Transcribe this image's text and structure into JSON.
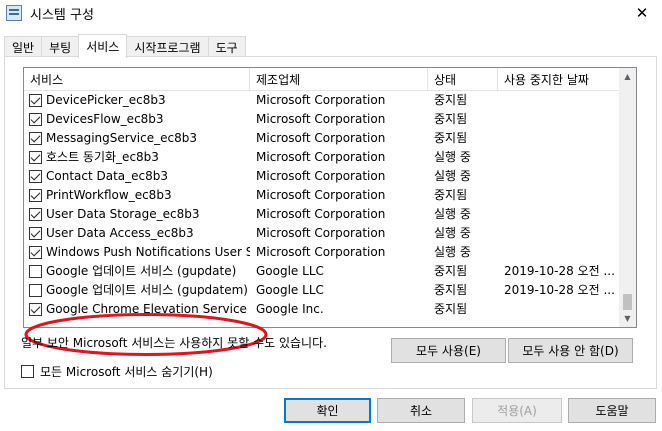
{
  "window": {
    "title": "시스템 구성",
    "close_glyph": "✕"
  },
  "tabs": [
    {
      "label": "일반",
      "active": false
    },
    {
      "label": "부팅",
      "active": false
    },
    {
      "label": "서비스",
      "active": true
    },
    {
      "label": "시작프로그램",
      "active": false
    },
    {
      "label": "도구",
      "active": false
    }
  ],
  "services": {
    "columns": [
      "서비스",
      "제조업체",
      "상태",
      "사용 중지한 날짜"
    ],
    "rows": [
      {
        "name": "DevicePicker_ec8b3",
        "maker": "Microsoft Corporation",
        "state": "중지됨",
        "date": "",
        "checked": true
      },
      {
        "name": "DevicesFlow_ec8b3",
        "maker": "Microsoft Corporation",
        "state": "중지됨",
        "date": "",
        "checked": true
      },
      {
        "name": "MessagingService_ec8b3",
        "maker": "Microsoft Corporation",
        "state": "중지됨",
        "date": "",
        "checked": true
      },
      {
        "name": "호스트 동기화_ec8b3",
        "maker": "Microsoft Corporation",
        "state": "실행 중",
        "date": "",
        "checked": true
      },
      {
        "name": "Contact Data_ec8b3",
        "maker": "Microsoft Corporation",
        "state": "실행 중",
        "date": "",
        "checked": true
      },
      {
        "name": "PrintWorkflow_ec8b3",
        "maker": "Microsoft Corporation",
        "state": "중지됨",
        "date": "",
        "checked": true
      },
      {
        "name": "User Data Storage_ec8b3",
        "maker": "Microsoft Corporation",
        "state": "실행 중",
        "date": "",
        "checked": true
      },
      {
        "name": "User Data Access_ec8b3",
        "maker": "Microsoft Corporation",
        "state": "실행 중",
        "date": "",
        "checked": true
      },
      {
        "name": "Windows Push Notifications User S...",
        "maker": "Microsoft Corporation",
        "state": "실행 중",
        "date": "",
        "checked": true
      },
      {
        "name": "Google 업데이트 서비스 (gupdate)",
        "maker": "Google LLC",
        "state": "중지됨",
        "date": "2019-10-28 오전 ...",
        "checked": false
      },
      {
        "name": "Google 업데이트 서비스 (gupdatem)",
        "maker": "Google LLC",
        "state": "중지됨",
        "date": "2019-10-28 오전 ...",
        "checked": false
      },
      {
        "name": "Google Chrome Elevation Service",
        "maker": "Google Inc.",
        "state": "중지됨",
        "date": "",
        "checked": true
      }
    ]
  },
  "warning_text": "일부 보안 Microsoft 서비스는 사용하지 못할 수도 있습니다.",
  "buttons": {
    "enable_all": "모두 사용(E)",
    "disable_all": "모두 사용 안 함(D)",
    "ok": "확인",
    "cancel": "취소",
    "apply": "적용(A)",
    "help": "도움말"
  },
  "hide_ms_label": "모든 Microsoft 서비스 숨기기(H)",
  "hide_ms_checked": false,
  "colors": {
    "annotation": "#e0141c",
    "focus": "#0078d7"
  }
}
